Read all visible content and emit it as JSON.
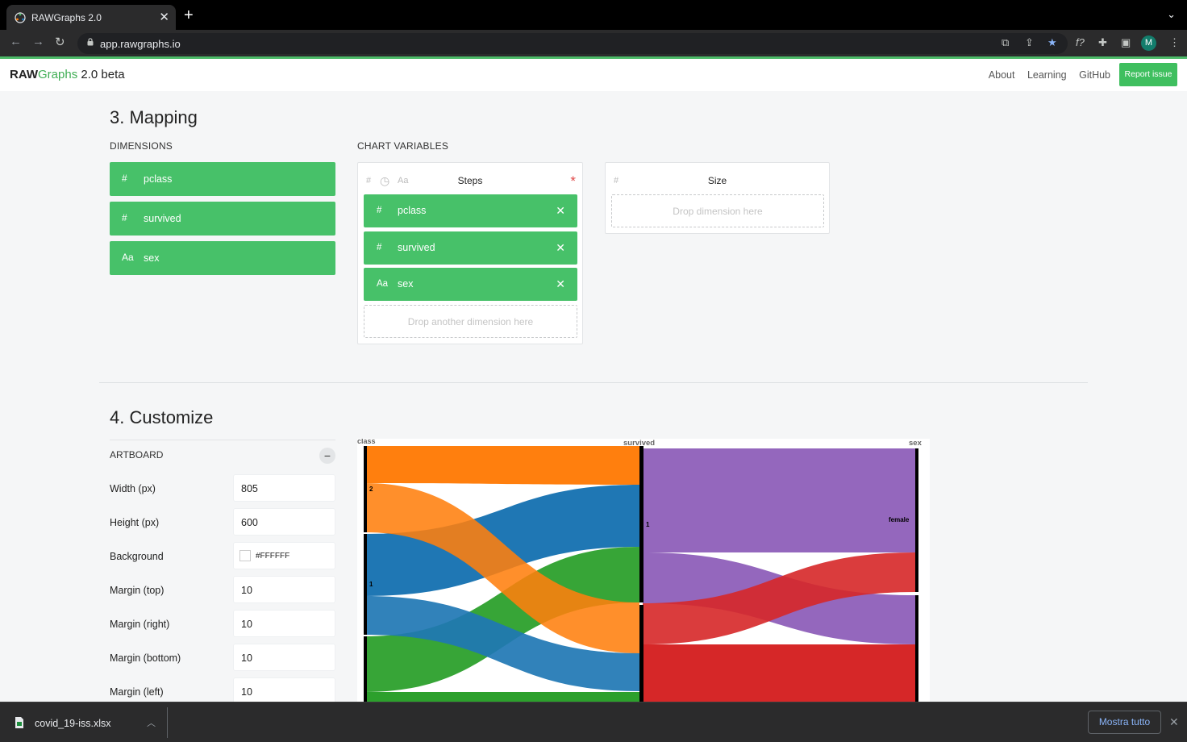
{
  "browser": {
    "tab_title": "RAWGraphs 2.0",
    "tab_close": "✕",
    "new_tab": "+",
    "url": "app.rawgraphs.io",
    "profile_initial": "M"
  },
  "app": {
    "brand_raw": "RAW",
    "brand_graphs": "Graphs",
    "brand_version": " 2.0 beta",
    "nav": [
      "About",
      "Learning",
      "GitHub"
    ],
    "report_label": "Report issue"
  },
  "mapping": {
    "title": "3. Mapping",
    "dimensions_label": "DIMENSIONS",
    "chart_variables_label": "CHART VARIABLES",
    "dimensions": [
      {
        "icon": "#",
        "label": "pclass"
      },
      {
        "icon": "#",
        "label": "survived"
      },
      {
        "icon": "Aa",
        "label": "sex"
      }
    ],
    "steps": {
      "title": "Steps",
      "type_hints": [
        "#",
        "◷",
        "Aa"
      ],
      "required_mark": "*",
      "items": [
        {
          "icon": "#",
          "label": "pclass"
        },
        {
          "icon": "#",
          "label": "survived"
        },
        {
          "icon": "Aa",
          "label": "sex"
        }
      ],
      "drop_hint": "Drop another dimension here"
    },
    "size": {
      "title": "Size",
      "type_hint": "#",
      "drop_hint": "Drop dimension here"
    }
  },
  "customize": {
    "title": "4. Customize",
    "artboard_label": "ARTBOARD",
    "collapse_symbol": "−",
    "fields": [
      {
        "label": "Width (px)",
        "value": "805"
      },
      {
        "label": "Height (px)",
        "value": "600"
      },
      {
        "label": "Background",
        "value": "#FFFFFF"
      },
      {
        "label": "Margin (top)",
        "value": "10"
      },
      {
        "label": "Margin (right)",
        "value": "10"
      },
      {
        "label": "Margin (bottom)",
        "value": "10"
      },
      {
        "label": "Margin (left)",
        "value": "10"
      }
    ]
  },
  "chart_data": {
    "type": "alluvial",
    "steps": [
      "pclass",
      "survived",
      "sex"
    ],
    "step_labels_visible": [
      "class",
      "survived",
      "sex"
    ],
    "node_labels": {
      "pclass": [
        "2",
        "1"
      ],
      "survived": [
        "1"
      ],
      "sex": [
        "female"
      ]
    },
    "colors": {
      "orange": "#ff7f0e",
      "blue": "#1f77b4",
      "green": "#2ca02c",
      "purple": "#9467bd",
      "red": "#d62728"
    }
  },
  "downloads": {
    "filename": "covid_19-iss.xlsx",
    "show_all": "Mostra tutto",
    "close": "✕"
  }
}
